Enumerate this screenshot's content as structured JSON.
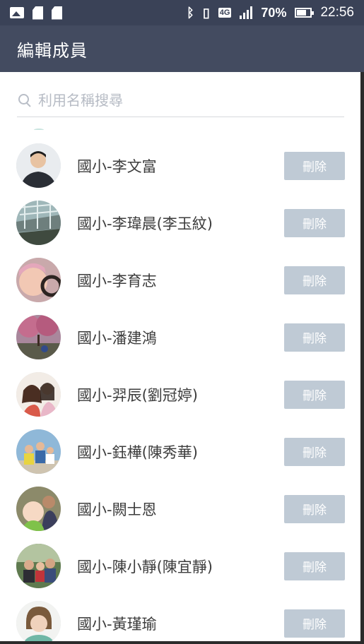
{
  "status_bar": {
    "icons": [
      "image-icon",
      "sd-card-icon",
      "sd-card-icon",
      "bluetooth-icon",
      "vibrate-icon",
      "4g-icon",
      "signal-icon",
      "battery-icon"
    ],
    "network_label": "4G",
    "battery_percent": "70%",
    "time": "22:56"
  },
  "header": {
    "title": "編輯成員"
  },
  "search": {
    "placeholder": "利用名稱搜尋"
  },
  "colors": {
    "status_bar_bg": "#3a4257",
    "header_bg": "#434b60",
    "delete_button_bg": "#bfcad5"
  },
  "members": [
    {
      "name": "國小-李文富",
      "action": "刪除",
      "avatar": "person-photo"
    },
    {
      "name": "國小-李瑋晨(李玉紋)",
      "action": "刪除",
      "avatar": "building-photo"
    },
    {
      "name": "國小-李育志",
      "action": "刪除",
      "avatar": "baby-photo"
    },
    {
      "name": "國小-潘建鴻",
      "action": "刪除",
      "avatar": "blossom-tree-photo"
    },
    {
      "name": "國小-羿辰(劉冠婷)",
      "action": "刪除",
      "avatar": "mother-child-photo"
    },
    {
      "name": "國小-鈺樺(陳秀華)",
      "action": "刪除",
      "avatar": "family-photo"
    },
    {
      "name": "國小-闕士恩",
      "action": "刪除",
      "avatar": "father-baby-photo"
    },
    {
      "name": "國小-陳小靜(陳宜靜)",
      "action": "刪除",
      "avatar": "group-photo"
    },
    {
      "name": "國小-黃瑾瑜",
      "action": "刪除",
      "avatar": "person-photo"
    }
  ]
}
